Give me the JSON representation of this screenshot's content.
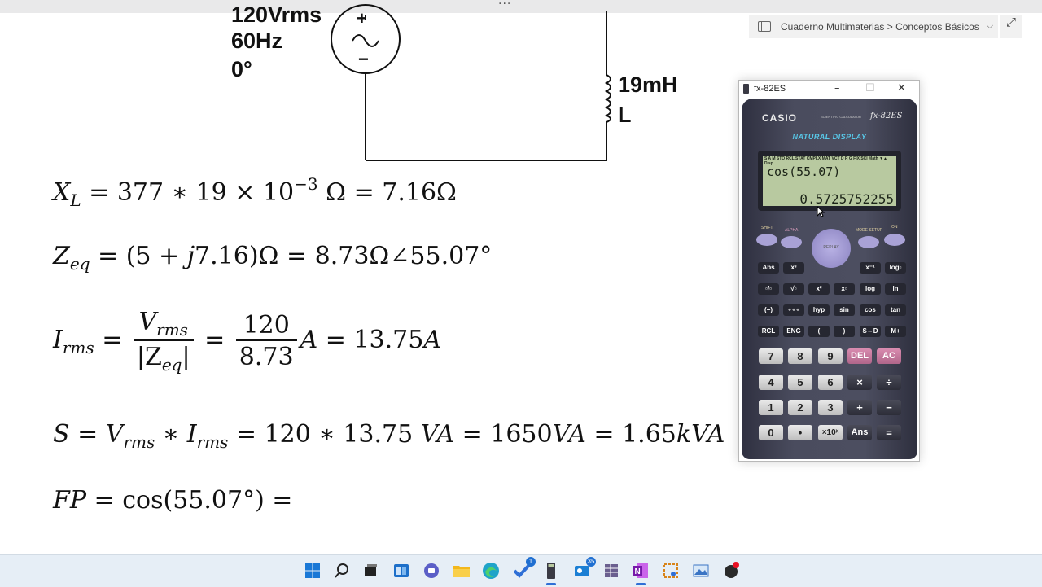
{
  "topbar": {
    "dots": "···"
  },
  "breadcrumb": {
    "text": "Cuaderno Multimaterias > Conceptos Básicos"
  },
  "circuit": {
    "source_label_1": "120Vrms",
    "source_label_2": "60Hz",
    "source_label_3": "0°",
    "plus": "+",
    "minus": "−",
    "inductor_label_1": "19mH",
    "inductor_label_2": "L"
  },
  "equations": {
    "xl": {
      "lhs": "X",
      "lhs_sub": "L",
      "body": " = 377 ∗ 19 × 10",
      "exp": "−3",
      "tail": " Ω = 7.16Ω"
    },
    "zeq": {
      "lhs": "Z",
      "lhs_sub": "eq",
      "body": " = (5 + ",
      "j": "j",
      "tail": "7.16)Ω = 8.73Ω∠55.07°"
    },
    "irms": {
      "lhs": "I",
      "lhs_sub": "rms",
      "eq1": " = ",
      "num1": "V",
      "num1_sub": "rms",
      "den1_a": "|Z",
      "den1_sub": "eq",
      "den1_b": "|",
      "eq2": " = ",
      "num2": "120",
      "den2": "8.73",
      "tail_a": "A",
      "tail_b": " = 13.75",
      "tail_c": "A"
    },
    "s": {
      "lhs": "S",
      "eq1": " = ",
      "v": "V",
      "v_sub": "rms",
      "mul": " ∗ ",
      "i": "I",
      "i_sub": "rms",
      "body": " = 120 ∗ 13.75 ",
      "va1": "VA",
      "mid": " = 1650",
      "va2": "VA",
      "mid2": " = 1.65",
      "kva": "kVA"
    },
    "fp": {
      "lhs": "FP",
      "body": " = cos(55.07°) ="
    }
  },
  "calculator_window": {
    "title": "fx-82ES",
    "brand": "CASIO",
    "sci_label": "SCIENTIFIC CALCULATOR",
    "model": "fx-82ES",
    "natural_display": "NATURAL DISPLAY",
    "indicators": "S A M STO RCL STAT CMPLX MAT VCT D R G FIX SCI Math ▼▲ Disp",
    "expression": "cos(55.07)",
    "result": "0.5725752255",
    "keys": {
      "shift": "SHIFT",
      "alpha": "ALPHA",
      "replay": "REPLAY",
      "mode": "MODE SETUP",
      "on": "ON",
      "row1": [
        "Abs",
        "x³",
        "x⁻¹",
        "log▫"
      ],
      "row2": [
        "▫/▫",
        "√▫",
        "x²",
        "x▫",
        "log",
        "ln"
      ],
      "row3": [
        "(−)",
        "∘∘∘",
        "hyp",
        "sin",
        "cos",
        "tan"
      ],
      "row4": [
        "RCL",
        "ENG",
        "(",
        ")",
        "S⇔D",
        "M+"
      ],
      "num1": [
        "7",
        "8",
        "9",
        "DEL",
        "AC"
      ],
      "num2": [
        "4",
        "5",
        "6",
        "×",
        "÷"
      ],
      "num3": [
        "1",
        "2",
        "3",
        "+",
        "−"
      ],
      "num4": [
        "0",
        "•",
        "×10ˣ",
        "Ans",
        "="
      ]
    }
  },
  "taskbar": {
    "icons": [
      "windows-start-icon",
      "search-icon",
      "task-view-icon",
      "widgets-icon",
      "teams-chat-icon",
      "file-explorer-icon",
      "edge-browser-icon",
      "todo-icon",
      "calculator-app-icon",
      "outlook-icon",
      "spreadsheet-icon",
      "onenote-icon",
      "snipping-tool-icon",
      "photos-icon",
      "recorder-icon"
    ],
    "badge_todo": "1",
    "badge_outlook": "35"
  }
}
